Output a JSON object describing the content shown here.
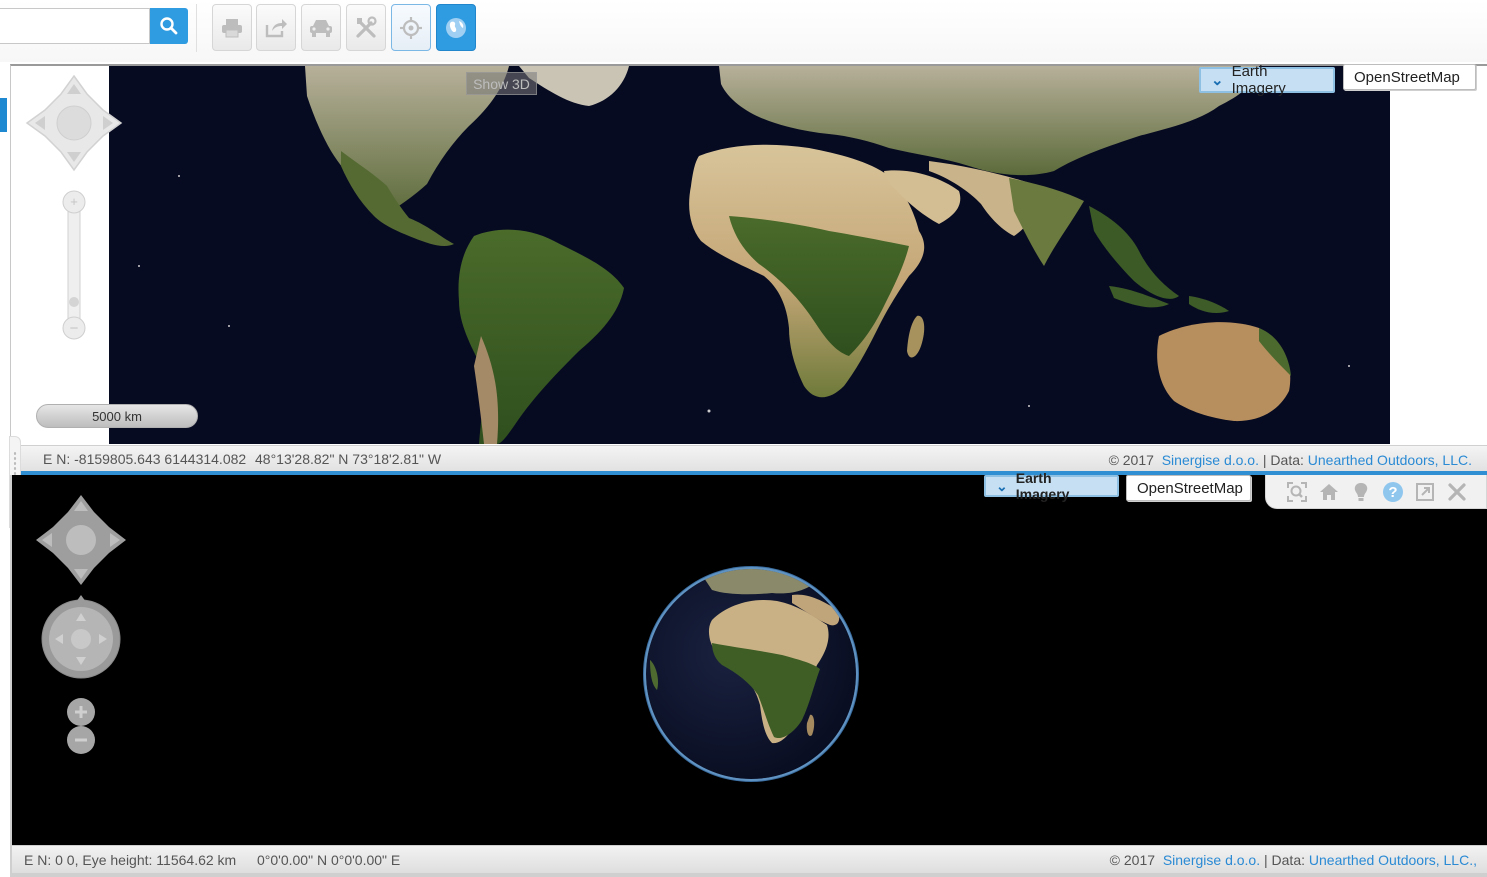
{
  "toolbar": {
    "search_placeholder": "",
    "buttons": [
      {
        "name": "print-button",
        "icon": "printer-icon"
      },
      {
        "name": "share-button",
        "icon": "share-icon"
      },
      {
        "name": "route-button",
        "icon": "car-icon"
      },
      {
        "name": "tools-button",
        "icon": "tools-icon"
      },
      {
        "name": "locate-button",
        "icon": "target-icon"
      },
      {
        "name": "globe-button",
        "icon": "globe-icon"
      }
    ]
  },
  "map2d": {
    "tooltip": "Show 3D",
    "scale": "5000 km",
    "layers": {
      "selected": "Earth Imagery",
      "other": "OpenStreetMap"
    },
    "status": {
      "projected_coords": "E N: -8159805.643 6144314.082",
      "geo_coords": "48°13'28.82\" N 73°18'2.81\" W",
      "copyright": "© 2017",
      "provider_link": "Sinergise d.o.o.",
      "data_label": "| Data:",
      "data_link": "Unearthed Outdoors, LLC."
    }
  },
  "map3d": {
    "layers": {
      "selected": "Earth Imagery",
      "other": "OpenStreetMap"
    },
    "icons": [
      "zoom-extent-icon",
      "home-icon",
      "bulb-icon",
      "help-icon",
      "fullscreen-icon",
      "close-icon"
    ],
    "status": {
      "coords": "E N: 0 0, Eye height: 11564.62 km",
      "geo_coords": "0°0'0.00\" N 0°0'0.00\" E",
      "copyright": "© 2017",
      "provider_link": "Sinergise d.o.o.",
      "data_label": "| Data:",
      "data_link": "Unearthed Outdoors, LLC.,"
    }
  },
  "colors": {
    "accent": "#2f9be0",
    "link": "#2a8ad4",
    "ocean": "#070b22"
  }
}
